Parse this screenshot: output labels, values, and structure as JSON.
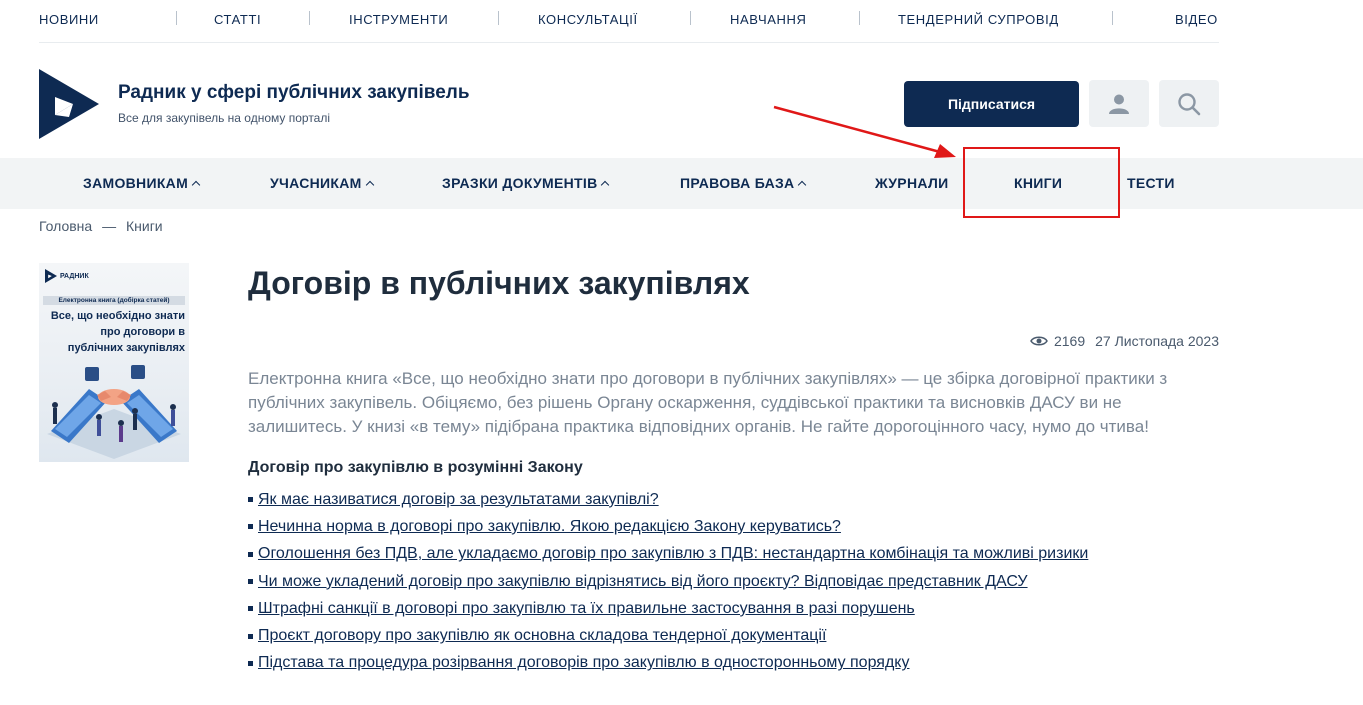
{
  "topnav": {
    "items": [
      "НОВИНИ",
      "СТАТТІ",
      "ІНСТРУМЕНТИ",
      "КОНСУЛЬТАЦІЇ",
      "НАВЧАННЯ",
      "ТЕНДЕРНИЙ СУПРОВІД",
      "ВІДЕО"
    ]
  },
  "header": {
    "title": "Радник у сфері публічних закупівель",
    "subtitle": "Все для закупівель на одному порталі",
    "subscribe_label": "Підписатися",
    "user_icon": "user-icon",
    "search_icon": "search-icon"
  },
  "mainnav": {
    "items": [
      {
        "label": "ЗАМОВНИКАМ",
        "dropdown": true
      },
      {
        "label": "УЧАСНИКАМ",
        "dropdown": true
      },
      {
        "label": "ЗРАЗКИ ДОКУМЕНТІВ",
        "dropdown": true
      },
      {
        "label": "ПРАВОВА БАЗА",
        "dropdown": true
      },
      {
        "label": "ЖУРНАЛИ",
        "dropdown": false
      },
      {
        "label": "КНИГИ",
        "dropdown": false
      },
      {
        "label": "ТЕСТИ",
        "dropdown": false
      }
    ]
  },
  "breadcrumb": {
    "home": "Головна",
    "separator": "—",
    "current": "Книги"
  },
  "cover": {
    "brand": "РАДНИК",
    "band": "Електронна книга (добірка статей)",
    "title": "Все, що необхідно знати про договори в публічних закупівлях"
  },
  "article": {
    "title": "Договір в публічних закупівлях",
    "views": "2169",
    "date": "27 Листопада 2023",
    "lead": "Електронна книга «Все, що необхідно знати про договори в публічних закупівлях» — це збірка договірної практики з публічних закупівель. Обіцяємо, без рішень Органу оскарження, суддівської практики та висновків ДАСУ ви не залишитесь. У книзі «в тему» підібрана практика відповідних органів. Не гайте дорогоцінного часу, нумо до чтива!",
    "section_title": "Договір про закупівлю в розумінні Закону",
    "links": [
      "Як має називатися договір за результатами закупівлі?",
      "Нечинна норма в договорі про закупівлю. Якою редакцією Закону керуватись?",
      "Оголошення без ПДВ, але укладаємо договір про закупівлю з ПДВ: нестандартна комбінація та можливі ризики",
      "Чи може укладений договір про закупівлю відрізнятись від його проєкту? Відповідає представник ДАСУ",
      "Штрафні санкції в договорі про закупівлю та їх правильне застосування в разі порушень",
      "Проєкт договору про закупівлю як основна складова тендерної документації",
      "Підстава та процедура розірвання договорів про закупівлю в односторонньому порядку"
    ]
  },
  "colors": {
    "brand": "#0e2a52",
    "annotation": "#e01818",
    "nav_bg": "#f2f4f5"
  }
}
